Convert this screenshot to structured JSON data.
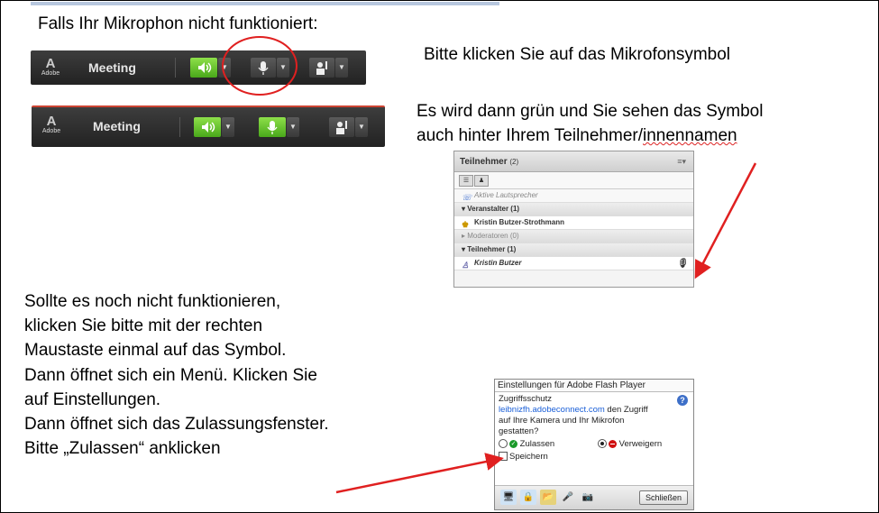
{
  "heading": "Falls Ihr Mikrophon nicht funktioniert:",
  "step1": "Bitte klicken Sie auf das Mikrofonsymbol",
  "step2_line1": "Es wird dann grün und Sie sehen das Symbol",
  "step2_line2_a": "auch hinter Ihrem Teilnehmer/",
  "step2_line2_b": "innennamen",
  "instructions": [
    "Sollte es noch nicht funktionieren,",
    "klicken Sie bitte mit der rechten",
    "Maustaste einmal auf das Symbol.",
    "Dann öffnet sich ein Menü. Klicken Sie",
    "auf Einstellungen.",
    "Dann öffnet sich das Zulassungsfenster.",
    "Bitte „Zulassen“ anklicken"
  ],
  "adobe_bar": {
    "logo_text": "Adobe",
    "meeting_label": "Meeting"
  },
  "panel": {
    "title": "Teilnehmer",
    "count": "(2)",
    "active_speakers": "Aktive Lautsprecher",
    "sections": [
      {
        "label": "Veranstalter (1)",
        "muted": false
      },
      {
        "label": "Moderatoren (0)",
        "muted": true
      },
      {
        "label": "Teilnehmer (1)",
        "muted": false
      }
    ],
    "host_name": "Kristin Butzer-Strothmann",
    "participant_name": "Kristin Butzer"
  },
  "flash": {
    "title": "Einstellungen für Adobe Flash Player",
    "section": "Zugriffsschutz",
    "link": "leibnizfh.adobeconnect.com",
    "question_rest": " den Zugriff",
    "question_line2": "auf Ihre Kamera und Ihr Mikrofon",
    "question_line3": "gestatten?",
    "allow": "Zulassen",
    "deny": "Verweigern",
    "remember": "Speichern",
    "close": "Schließen"
  },
  "colors": {
    "accent_green": "#49a81a",
    "arrow_red": "#e02020",
    "link_blue": "#1a5fd8"
  }
}
